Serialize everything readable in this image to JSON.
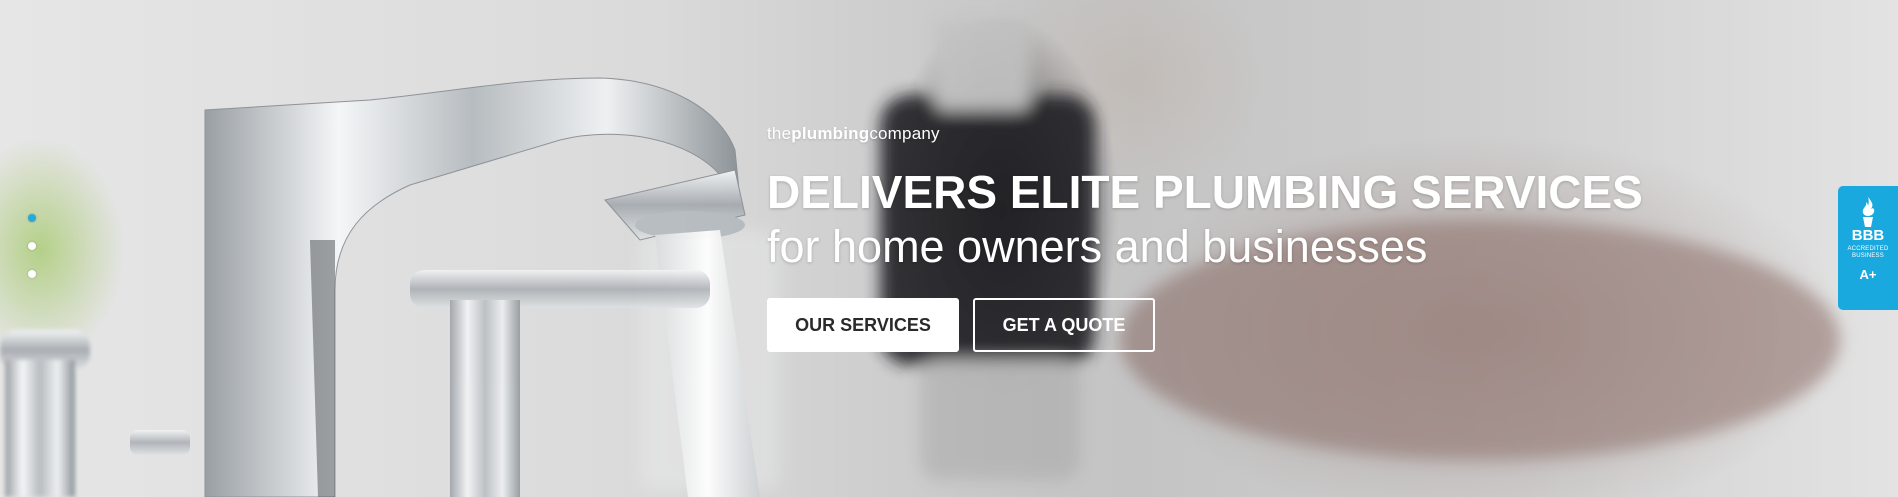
{
  "brand": {
    "prefix": "the",
    "emphasis": "plumbing",
    "suffix": "company"
  },
  "hero": {
    "headline": "DELIVERS ELITE PLUMBING SERVICES",
    "subline": "for home owners and businesses",
    "buttons": {
      "services_label": "OUR SERVICES",
      "quote_label": "GET A QUOTE"
    }
  },
  "slider": {
    "slide_count": 3,
    "active_index": 0
  },
  "bbb_badge": {
    "title": "BBB",
    "line1": "ACCREDITED",
    "line2": "BUSINESS",
    "rating": "A+",
    "icon": "bbb-torch-icon"
  },
  "colors": {
    "accent": "#1aa9de",
    "active_dot": "#29a9d8",
    "text_light": "#ffffff",
    "button_text": "#2a2a2a"
  }
}
